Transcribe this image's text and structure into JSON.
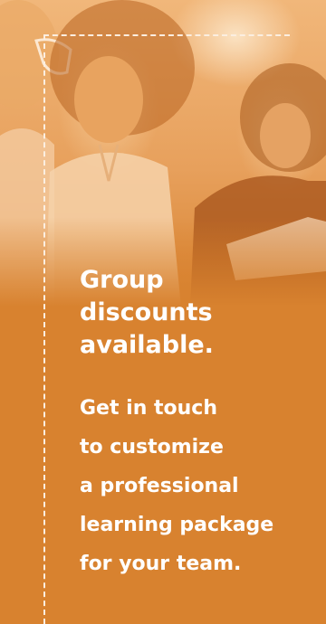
{
  "promo": {
    "headline_lines": [
      "Group",
      "discounts",
      "available."
    ],
    "body_lines": [
      "Get in touch",
      "to customize",
      "a professional",
      "learning package",
      "for your team."
    ]
  },
  "colors": {
    "background": "#d8822f",
    "text": "#ffffff",
    "dash": "#fbeee0"
  },
  "photo": {
    "subject": "people-in-meeting-image"
  }
}
